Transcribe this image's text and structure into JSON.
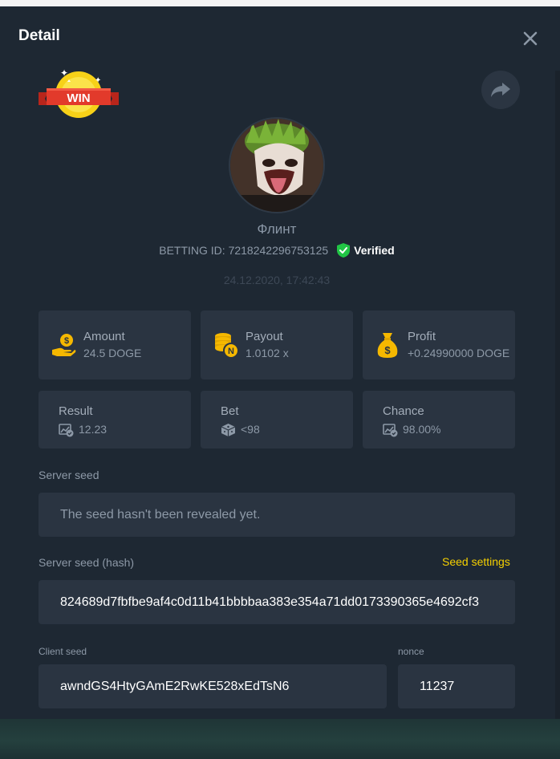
{
  "modal": {
    "title": "Detail"
  },
  "badge": {
    "text": "WIN"
  },
  "user": {
    "name": "Флинт",
    "betting_id": "BETTING ID: 7218242296753125",
    "verified_label": "Verified"
  },
  "timestamp": "24.12.2020, 17:42:43",
  "stats": {
    "amount": {
      "label": "Amount",
      "value": "24.5 DOGE"
    },
    "payout": {
      "label": "Payout",
      "value": "1.0102 x"
    },
    "profit": {
      "label": "Profit",
      "value": "+0.24990000 DOGE"
    },
    "result": {
      "label": "Result",
      "value": "12.23"
    },
    "bet": {
      "label": "Bet",
      "value": "<98"
    },
    "chance": {
      "label": "Chance",
      "value": "98.00%"
    }
  },
  "seeds": {
    "server_seed_label": "Server seed",
    "server_seed_value": "The seed hasn't been revealed yet.",
    "server_hash_label": "Server seed (hash)",
    "seed_settings_label": "Seed settings",
    "server_hash_value": "824689d7fbfbe9af4c0d11b41bbbbaa383e354a71dd0173390365e4692cf3",
    "client_seed_label": "Client seed",
    "client_seed_value": "awndGS4HtyGAmE2RwKE528xEdTsN6",
    "nonce_label": "nonce",
    "nonce_value": "11237"
  },
  "colors": {
    "accent": "#f5d000",
    "verified": "#21c545",
    "card": "#2a3441",
    "background": "#1e2833"
  },
  "icons": [
    "close-icon",
    "share-icon",
    "hand-coin-icon",
    "coin-stack-icon",
    "money-bag-icon",
    "dice-icon",
    "verified-shield-icon"
  ]
}
